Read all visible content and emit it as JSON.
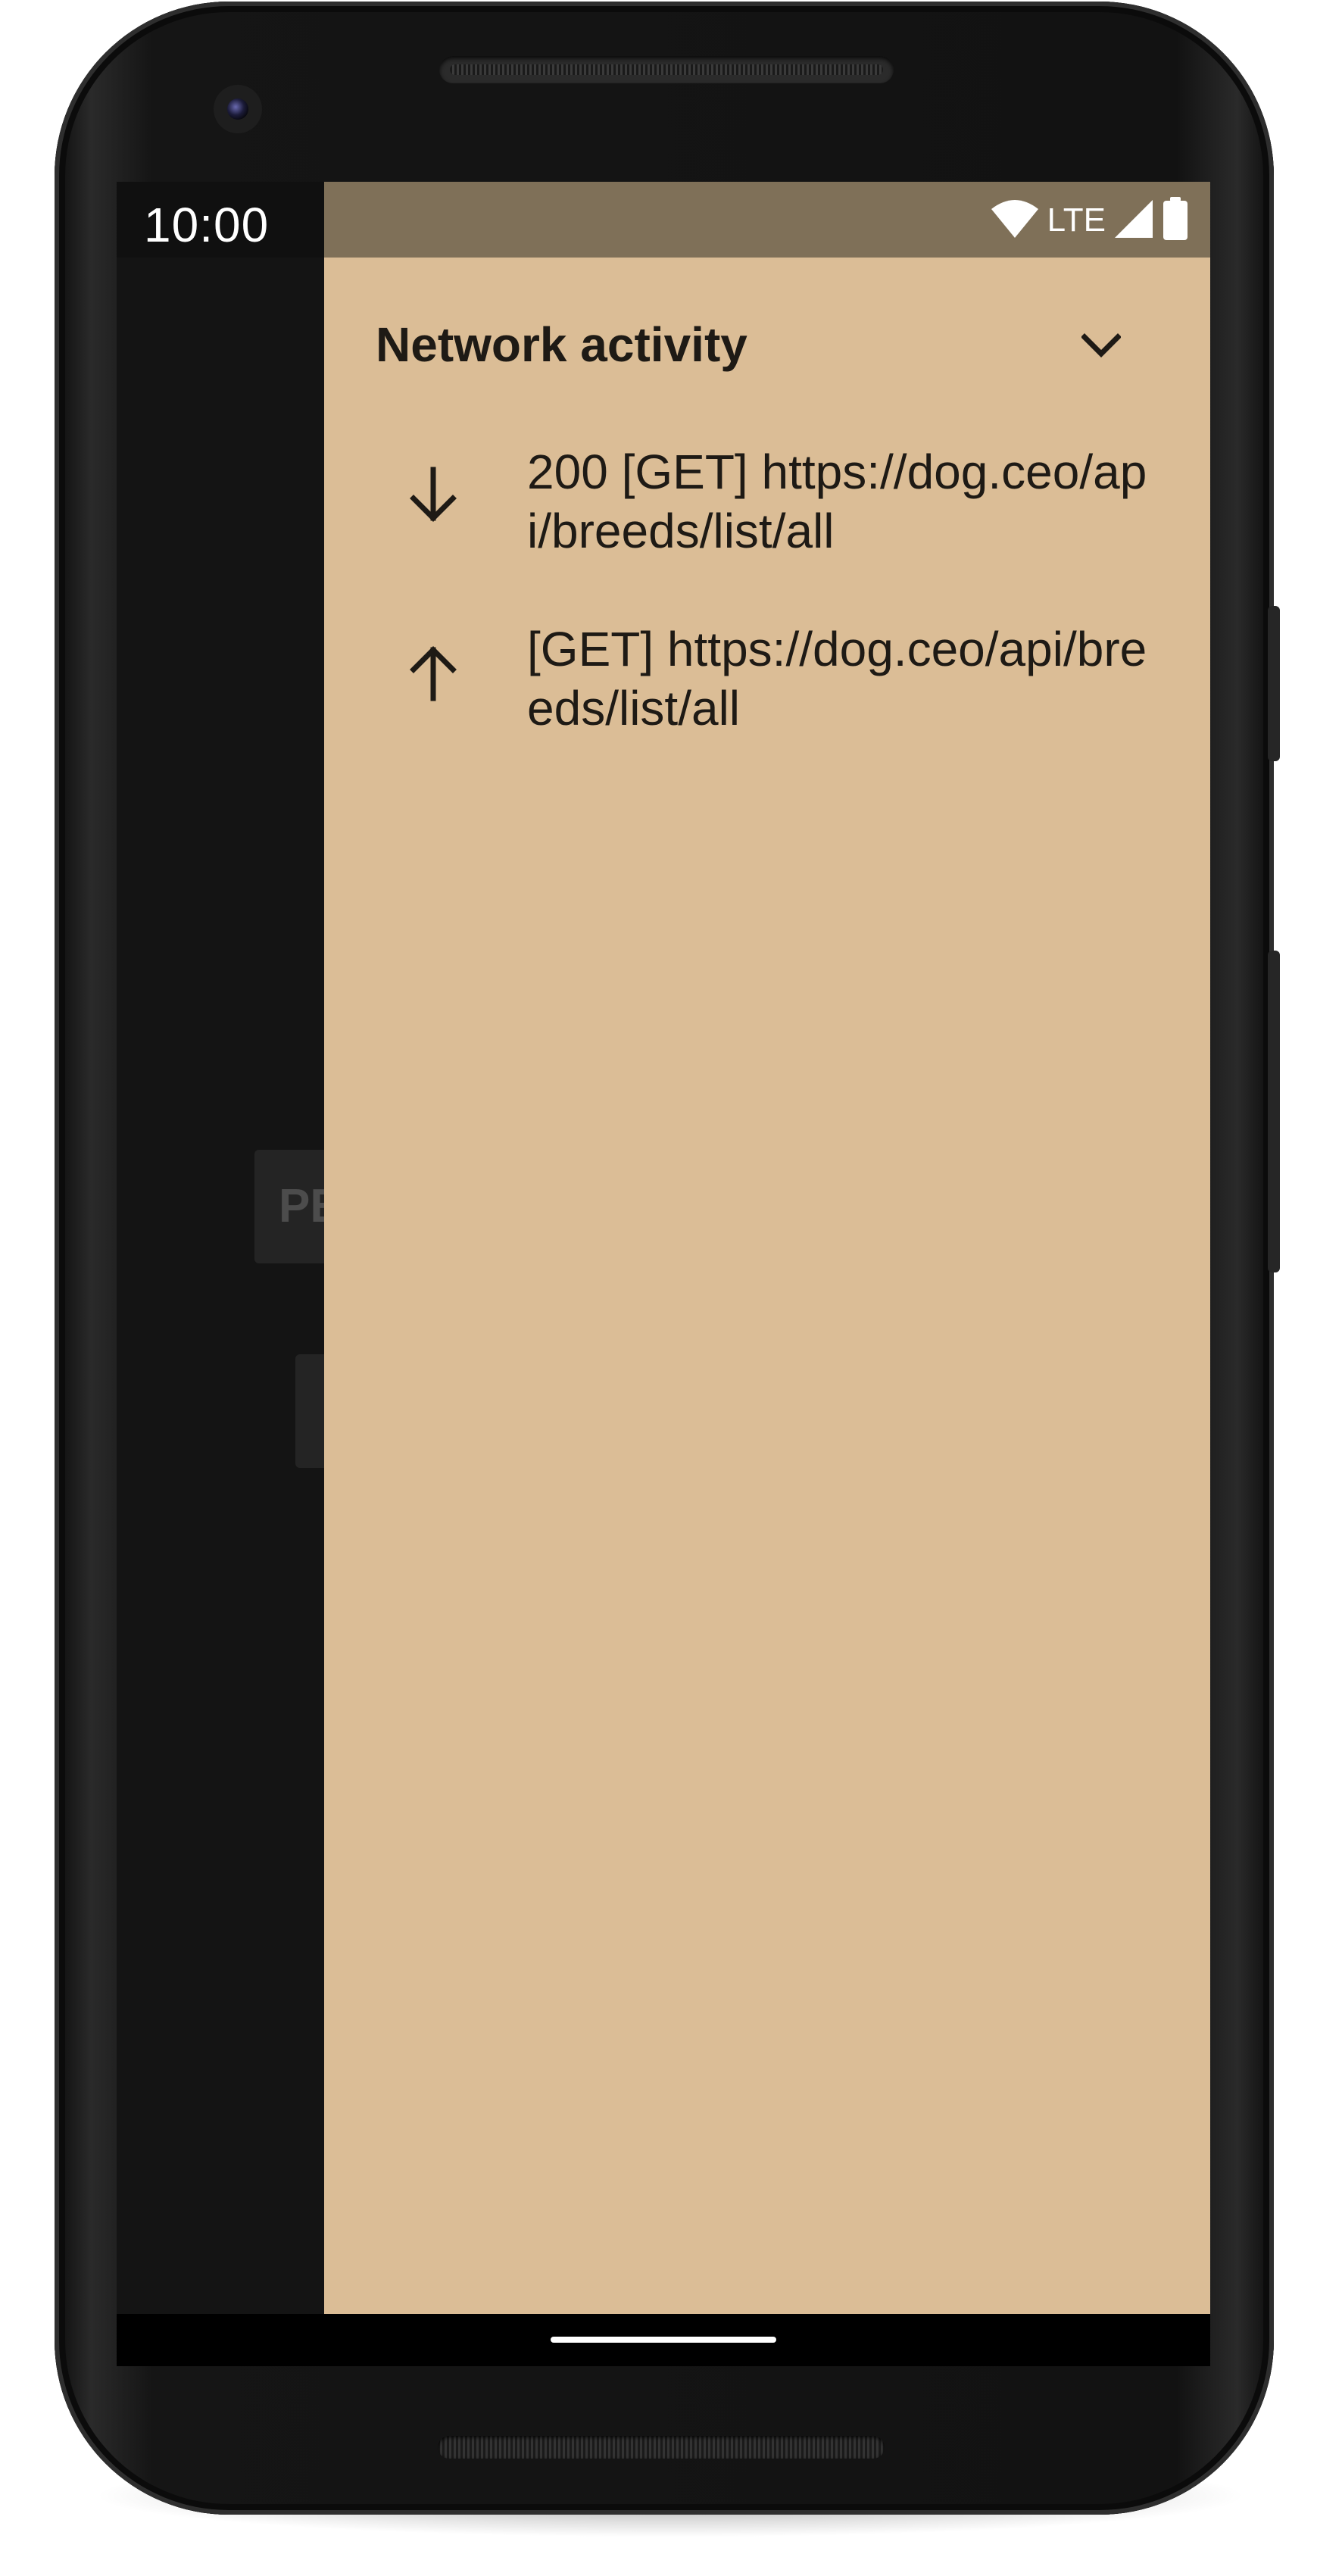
{
  "status_bar": {
    "time": "10:00",
    "network_type": "LTE",
    "icons": [
      "wifi-icon",
      "cellular-signal-icon",
      "battery-icon"
    ]
  },
  "background_app": {
    "button_partial_label": "PE"
  },
  "drawer": {
    "title": "Network activity",
    "collapse_icon": "chevron-down-icon",
    "background_color": "#dbbd96",
    "status_color": "#7f7058",
    "entries": [
      {
        "direction": "response",
        "icon": "arrow-down-icon",
        "text": "200 [GET] https://dog.ceo/api/breeds/list/all"
      },
      {
        "direction": "request",
        "icon": "arrow-up-icon",
        "text": "[GET] https://dog.ceo/api/breeds/list/all"
      }
    ]
  }
}
